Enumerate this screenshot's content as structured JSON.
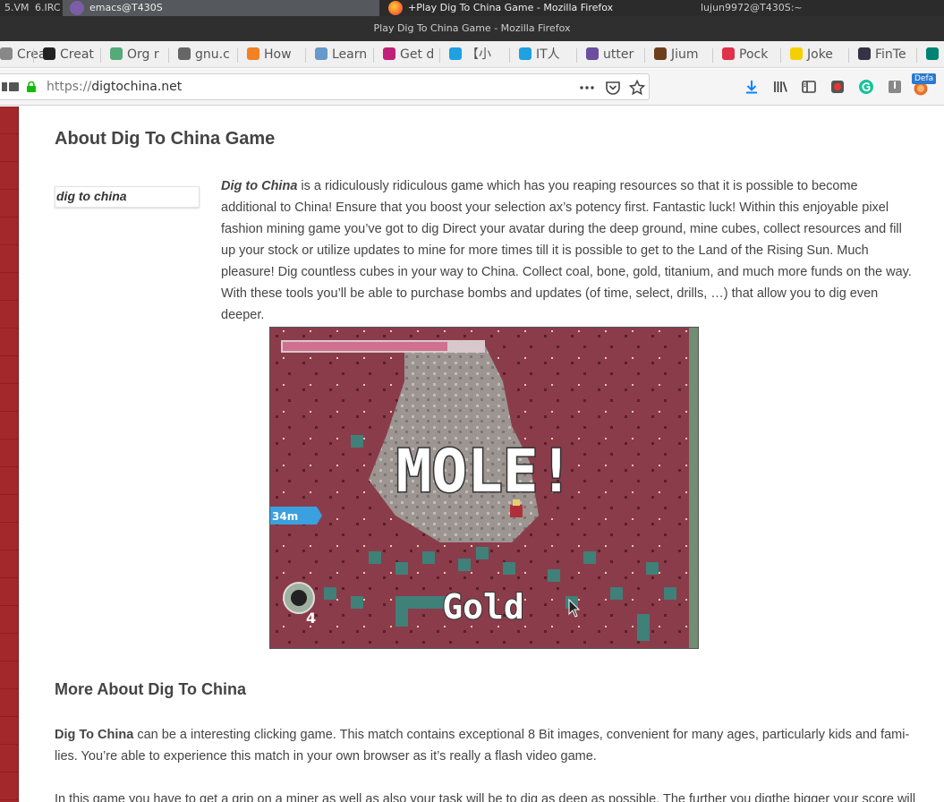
{
  "system_bar": {
    "workspace_5": "5.VM",
    "workspace_6": "6.IRC",
    "task_emacs": "emacs@T430S",
    "task_firefox": "+Play Dig To China Game - Mozilla Firefox",
    "terminal": "lujun9972@T430S:~"
  },
  "window": {
    "title": "Play Dig To China Game - Mozilla Firefox"
  },
  "bookmarks": [
    {
      "label": "Crea",
      "icon": "doc-icon",
      "color": "#888"
    },
    {
      "label": "Creat",
      "icon": "hex-icon",
      "color": "#222"
    },
    {
      "label": "Org r",
      "icon": "org-icon",
      "color": "#5a7"
    },
    {
      "label": "gnu.c",
      "icon": "gnu-icon",
      "color": "#666"
    },
    {
      "label": "How",
      "icon": "stack-icon",
      "color": "#f48024"
    },
    {
      "label": "Learn",
      "icon": "learn-icon",
      "color": "#69c"
    },
    {
      "label": "Get d",
      "icon": "hash-icon",
      "color": "#c0207a"
    },
    {
      "label": "【小",
      "icon": "bili-icon",
      "color": "#1ea0e1"
    },
    {
      "label": "IT人",
      "icon": "bili-icon",
      "color": "#1ea0e1"
    },
    {
      "label": "utter",
      "icon": "utter-icon",
      "color": "#6b4ea0"
    },
    {
      "label": "Jium",
      "icon": "j-icon",
      "color": "#6b3f1e"
    },
    {
      "label": "Pock",
      "icon": "pocket-icon",
      "color": "#e0304a"
    },
    {
      "label": "Joke",
      "icon": "smiley-icon",
      "color": "#f5d000"
    },
    {
      "label": "FinTe",
      "icon": "fin-icon",
      "color": "#334"
    },
    {
      "label": "",
      "icon": "bing-icon",
      "color": "#008373"
    }
  ],
  "navbar": {
    "url_protocol": "https://",
    "url_host": "digtochina.net",
    "badge": "Defa"
  },
  "article": {
    "heading1": "About Dig To China Game",
    "image_alt": "dig to china",
    "intro_bold": "Dig to China",
    "intro_rest": " is a ridiculously ridiculous game which has you reaping resources so that it is possible to become additional to China! Ensure that you boost your selection ax’s potency first. Fantastic luck! Within this enjoyable pixel fashion mining game you’ve got to dig Direct your avatar during the deep ground, mine cubes, collect resources and fill up your stock or utilize updates to mine for more times till it is possible to get to the Land of the Rising Sun. Much pleasure! Dig countless cubes in your way to China. Collect coal, bone, gold, tita­nium, and much more funds on the way. With these tools you’ll be able to purchase bombs and updates (of time, select, drills, …) that allow you to dig even deeper.",
    "game": {
      "banner": "MOLE!",
      "pickup": "Gold",
      "depth": "34m",
      "bombs": "4",
      "health_level": 0.82
    },
    "heading2": "More About Dig To China",
    "p2_bold": "Dig To China",
    "p2_rest": " can be a interesting clicking game. This match contains exceptional 8 Bit images, convenient for many ages, particularly kids and fami­lies. You’re able to experience this match in your own browser as it’s really a flash video game.",
    "p3": "In this game you have to get a grip on a miner as well as also your task will be to dig as deep as possible. The further you digthe bigger your score will"
  }
}
